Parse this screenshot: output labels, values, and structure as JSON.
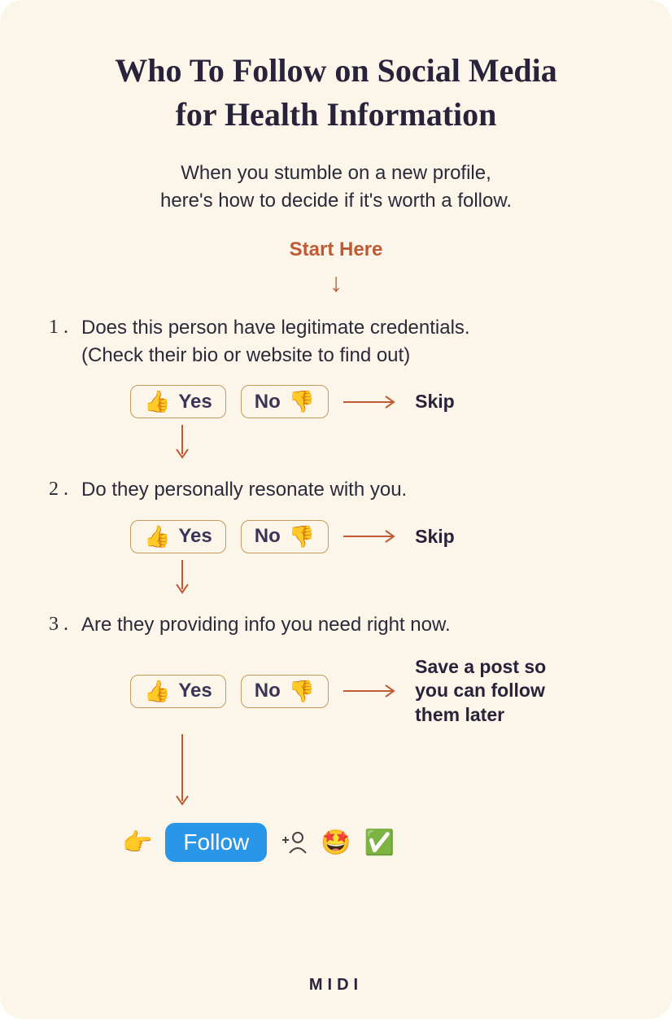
{
  "title_line1": "Who To Follow on Social Media",
  "title_line2": "for Health Information",
  "subtitle_line1": "When you stumble on a new profile,",
  "subtitle_line2": "here's how to decide if it's worth a follow.",
  "start_here": "Start Here",
  "steps": [
    {
      "num": "1 .",
      "text_line1": "Does this person have legitimate credentials.",
      "text_line2": "(Check their bio or website to find out)",
      "yes": "Yes",
      "no": "No",
      "no_result": "Skip"
    },
    {
      "num": "2 .",
      "text_line1": "Do they personally resonate with you.",
      "yes": "Yes",
      "no": "No",
      "no_result": "Skip"
    },
    {
      "num": "3 .",
      "text_line1": "Are they providing info you need right now.",
      "yes": "Yes",
      "no": "No",
      "no_result": "Save a post so you can follow them later"
    }
  ],
  "follow_label": "Follow",
  "footer": "MIDI",
  "icons": {
    "thumbs_up": "👍",
    "thumbs_down": "👎",
    "point_right": "👉",
    "star_struck": "🤩",
    "check": "✅"
  }
}
